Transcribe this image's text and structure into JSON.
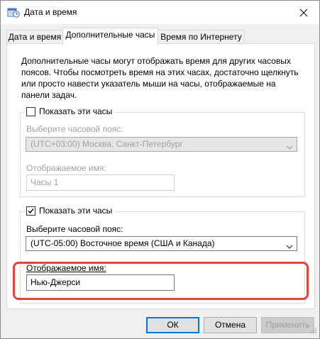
{
  "window": {
    "title": "Дата и время",
    "icon": "calendar-clock-icon"
  },
  "tabs": [
    {
      "label": "Дата и время",
      "active": false
    },
    {
      "label": "Дополнительные часы",
      "active": true
    },
    {
      "label": "Время по Интернету",
      "active": false
    }
  ],
  "description": "Дополнительные часы могут отображать время для других часовых поясов. Чтобы посмотреть время на этих часах, достаточно щелкнуть или просто навести указатель мыши на часы, отображаемые на панели задач.",
  "clock1": {
    "show_label": "Показать эти часы",
    "checked": false,
    "timezone_label": "Выберите часовой пояс:",
    "timezone_value": "(UTC+03:00) Москва, Санкт-Петербург",
    "display_name_label": "Отображаемое имя:",
    "display_name_value": "Часы 1"
  },
  "clock2": {
    "show_label": "Показать эти часы",
    "checked": true,
    "timezone_label": "Выберите часовой пояс:",
    "timezone_value": "(UTC-05:00) Восточное время (США и Канада)",
    "display_name_label": "Отображаемое имя:",
    "display_name_value": "Нью-Джерси"
  },
  "buttons": {
    "ok": "ОК",
    "cancel": "Отмена",
    "apply": "Применить"
  },
  "colors": {
    "highlight": "#e0463c",
    "default_button_border": "#0078d7"
  }
}
